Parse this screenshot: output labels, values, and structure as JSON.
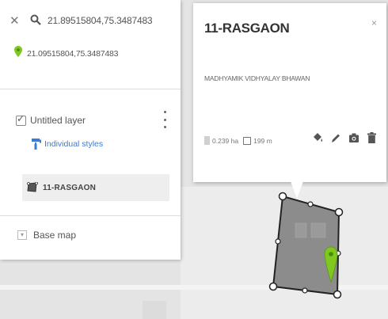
{
  "search": {
    "query": "21.89515804,75.3487483",
    "close_icon": "close-icon",
    "search_icon": "search-icon"
  },
  "location": {
    "coordinates": "21.09515804,75.3487483",
    "marker_color": "#7ec820"
  },
  "layer": {
    "name": "Untitled layer",
    "checked": true,
    "styles_link": "Individual styles",
    "features": [
      {
        "name": "11-RASGAON"
      }
    ]
  },
  "basemap": {
    "label": "Base map"
  },
  "info_card": {
    "title": "11-RASGAON",
    "description": "MADHYAMIK VIDHYALAY BHAWAN",
    "area": "0.239 ha",
    "perimeter": "199 m",
    "close_glyph": "×"
  },
  "colors": {
    "link": "#3a7bd5",
    "polygon_fill": "#8c8c8c",
    "marker": "#7ec820"
  }
}
